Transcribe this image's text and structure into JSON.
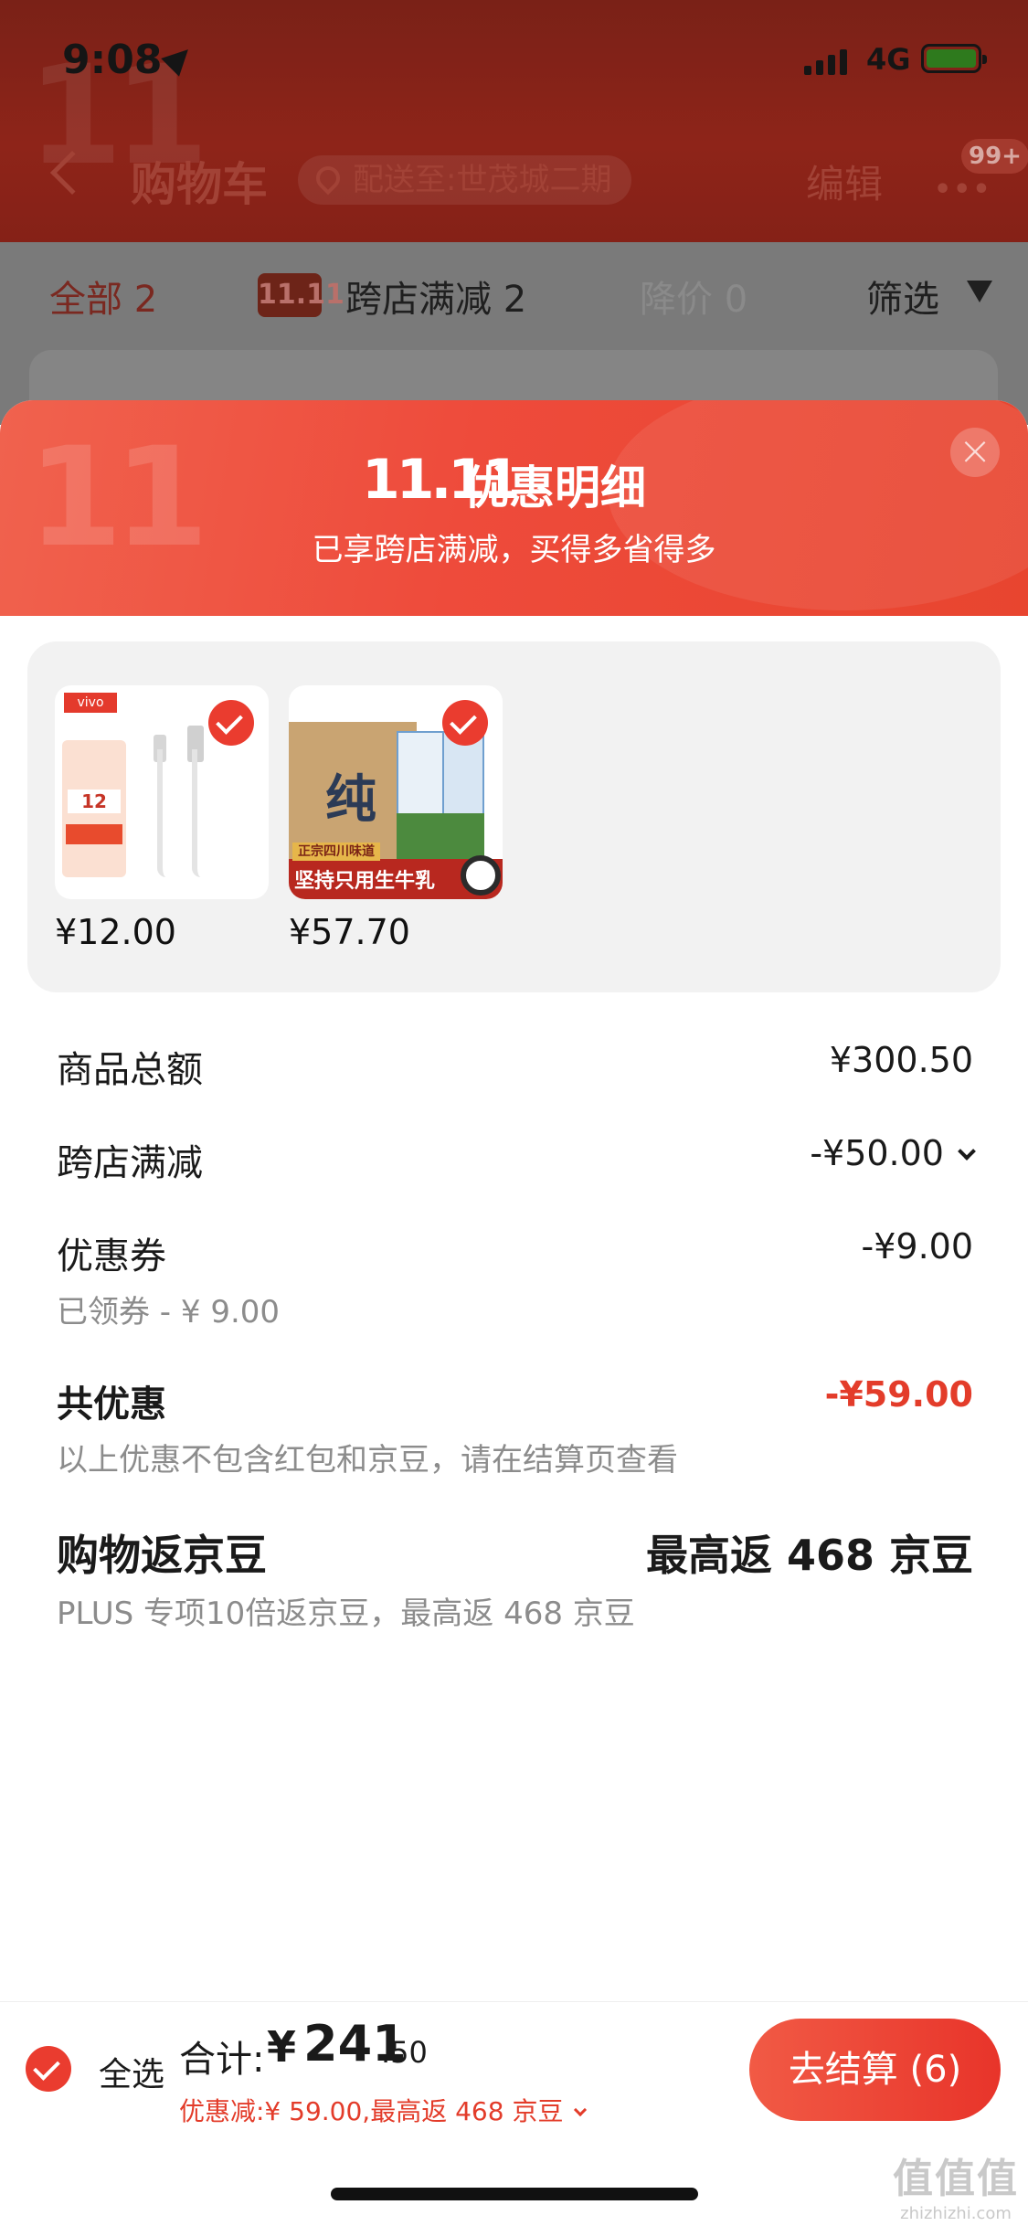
{
  "status_bar": {
    "time": "9:08",
    "network": "4G"
  },
  "nav": {
    "title": "购物车",
    "address": "配送至:世茂城二期",
    "edit": "编辑",
    "more": "•••",
    "badge": "99+"
  },
  "tabs": {
    "all": "全部 2",
    "cross_store": "跨店满减 2",
    "price_drop": "降价 0",
    "filter": "筛选",
    "cross_store_icon": "11.11"
  },
  "sheet": {
    "logo": "11.11",
    "title": "优惠明细",
    "subtitle": "已享跨店满减，买得多省得多",
    "close": "×"
  },
  "products": [
    {
      "price": "¥12.00",
      "brand": "vivo",
      "card_value": "12",
      "selected": true
    },
    {
      "price": "¥57.70",
      "box_text": "纯",
      "strip_top": "正宗四川味道",
      "strip_text": "坚持只用生牛乳",
      "selected": true
    }
  ],
  "details": {
    "goods_total_label": "商品总额",
    "goods_total_value": "¥300.50",
    "cross_store_label": "跨店满减",
    "cross_store_value": "-¥50.00",
    "coupon_label": "优惠券",
    "coupon_value": "-¥9.00",
    "coupon_sub": "已领券 - ¥ 9.00",
    "total_discount_label": "共优惠",
    "total_discount_value": "-¥59.00",
    "total_discount_note": "以上优惠不包含红包和京豆，请在结算页查看",
    "beans_label": "购物返京豆",
    "beans_value": "最高返 468 京豆",
    "beans_note": "PLUS 专项10倍返京豆，最高返 468 京豆"
  },
  "bottom_bar": {
    "select_all": "全选",
    "sum_label": "合计:",
    "sum_currency": "¥",
    "sum_integer": "241",
    "sum_decimal": ".50",
    "discount_line": "优惠减:¥ 59.00,最高返 468 京豆",
    "checkout": "去结算 (6)"
  },
  "watermark": {
    "logo": "值值值",
    "url": "zhizhizhi.com"
  },
  "colors": {
    "accent": "#e33c2a",
    "sheet_header": "#ee4b3b",
    "checkout": "#e8342a"
  }
}
